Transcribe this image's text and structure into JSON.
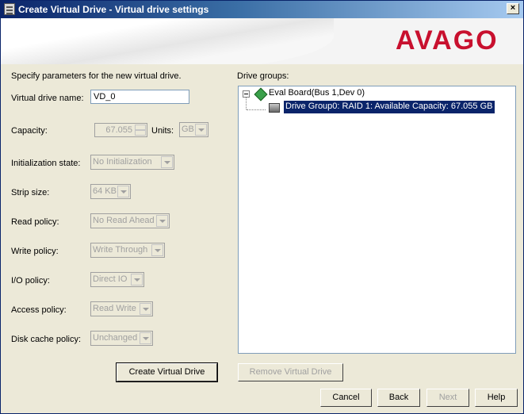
{
  "window": {
    "title": "Create Virtual Drive - Virtual drive settings",
    "close_glyph": "×"
  },
  "brand": {
    "logo_text": "AVAGO"
  },
  "form": {
    "intro": "Specify parameters for the new virtual drive.",
    "name_label": "Virtual drive name:",
    "name_value": "VD_0",
    "capacity_label": "Capacity:",
    "capacity_value": "67.055",
    "units_label": "Units:",
    "units_value": "GB",
    "init_label": "Initialization state:",
    "init_value": "No Initialization",
    "strip_label": "Strip size:",
    "strip_value": "64 KB",
    "read_label": "Read policy:",
    "read_value": "No Read Ahead",
    "write_label": "Write policy:",
    "write_value": "Write Through",
    "io_label": "I/O policy:",
    "io_value": "Direct IO",
    "access_label": "Access policy:",
    "access_value": "Read Write",
    "disk_cache_label": "Disk cache policy:",
    "disk_cache_value": "Unchanged",
    "create_button": "Create Virtual Drive"
  },
  "drive_groups": {
    "label": "Drive groups:",
    "root_node": "Eval Board(Bus 1,Dev 0)",
    "child_node": "Drive Group0: RAID 1: Available Capacity: 67.055 GB",
    "remove_button": "Remove Virtual Drive"
  },
  "footer": {
    "cancel": "Cancel",
    "back": "Back",
    "next": "Next",
    "help": "Help"
  },
  "colors": {
    "title_bar": "#0a246a",
    "brand_red": "#c8102e",
    "selection": "#0a246a",
    "dialog_bg": "#ece9d8"
  }
}
